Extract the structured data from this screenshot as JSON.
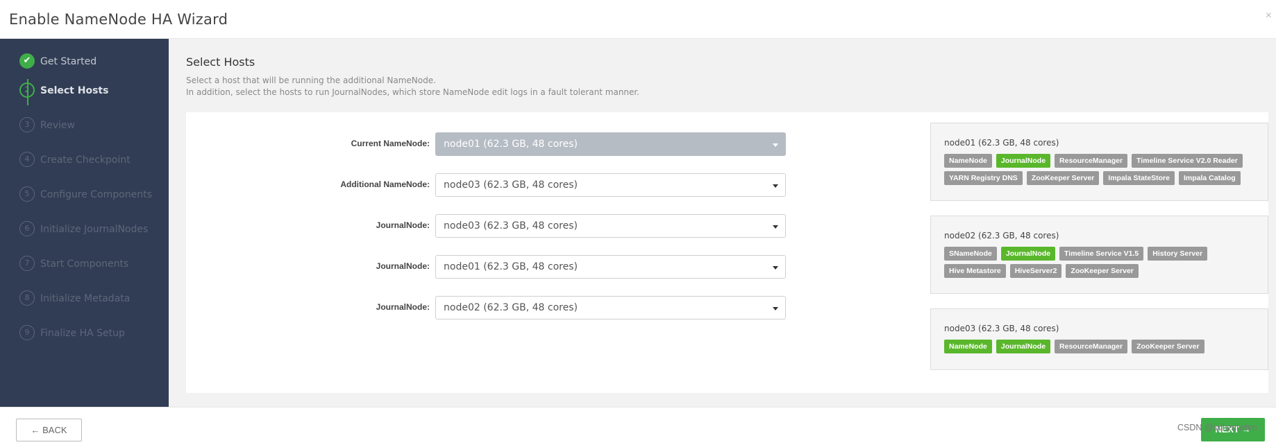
{
  "window": {
    "title": "Enable NameNode HA Wizard",
    "close_glyph": "×"
  },
  "steps": [
    {
      "number": "✔",
      "label": "Get Started",
      "state": "done"
    },
    {
      "number": "2",
      "label": "Select Hosts",
      "state": "active"
    },
    {
      "number": "3",
      "label": "Review",
      "state": "pending"
    },
    {
      "number": "4",
      "label": "Create Checkpoint",
      "state": "pending"
    },
    {
      "number": "5",
      "label": "Configure Components",
      "state": "pending"
    },
    {
      "number": "6",
      "label": "Initialize JournalNodes",
      "state": "pending"
    },
    {
      "number": "7",
      "label": "Start Components",
      "state": "pending"
    },
    {
      "number": "8",
      "label": "Initialize Metadata",
      "state": "pending"
    },
    {
      "number": "9",
      "label": "Finalize HA Setup",
      "state": "pending"
    }
  ],
  "main": {
    "title": "Select Hosts",
    "desc1": "Select a host that will be running the additional NameNode.",
    "desc2": "In addition, select the hosts to run JournalNodes, which store NameNode edit logs in a fault tolerant manner."
  },
  "assignments": [
    {
      "label": "Current NameNode:",
      "value": "node01 (62.3 GB, 48 cores)",
      "disabled": true
    },
    {
      "label": "Additional NameNode:",
      "value": "node03 (62.3 GB, 48 cores)",
      "disabled": false
    },
    {
      "label": "JournalNode:",
      "value": "node03 (62.3 GB, 48 cores)",
      "disabled": false
    },
    {
      "label": "JournalNode:",
      "value": "node01 (62.3 GB, 48 cores)",
      "disabled": false
    },
    {
      "label": "JournalNode:",
      "value": "node02 (62.3 GB, 48 cores)",
      "disabled": false
    }
  ],
  "hosts": [
    {
      "name": "node01 (62.3 GB, 48 cores)",
      "components": [
        {
          "label": "NameNode",
          "highlight": false
        },
        {
          "label": "JournalNode",
          "highlight": true
        },
        {
          "label": "ResourceManager",
          "highlight": false
        },
        {
          "label": "Timeline Service V2.0 Reader",
          "highlight": false
        },
        {
          "label": "YARN Registry DNS",
          "highlight": false
        },
        {
          "label": "ZooKeeper Server",
          "highlight": false
        },
        {
          "label": "Impala StateStore",
          "highlight": false
        },
        {
          "label": "Impala Catalog",
          "highlight": false
        }
      ]
    },
    {
      "name": "node02 (62.3 GB, 48 cores)",
      "components": [
        {
          "label": "SNameNode",
          "highlight": false
        },
        {
          "label": "JournalNode",
          "highlight": true
        },
        {
          "label": "Timeline Service V1.5",
          "highlight": false
        },
        {
          "label": "History Server",
          "highlight": false
        },
        {
          "label": "Hive Metastore",
          "highlight": false
        },
        {
          "label": "HiveServer2",
          "highlight": false
        },
        {
          "label": "ZooKeeper Server",
          "highlight": false
        }
      ]
    },
    {
      "name": "node03 (62.3 GB, 48 cores)",
      "components": [
        {
          "label": "NameNode",
          "highlight": true
        },
        {
          "label": "JournalNode",
          "highlight": true
        },
        {
          "label": "ResourceManager",
          "highlight": false
        },
        {
          "label": "ZooKeeper Server",
          "highlight": false
        }
      ]
    }
  ],
  "footer": {
    "back_label": "← BACK",
    "next_label": "NEXT →",
    "watermark": "CSDN @sdhzdtwhm"
  },
  "colors": {
    "accent_green": "#3fae49",
    "sidebar_bg": "#313d54",
    "tag_green": "#5ab72c",
    "tag_gray": "#999999"
  }
}
